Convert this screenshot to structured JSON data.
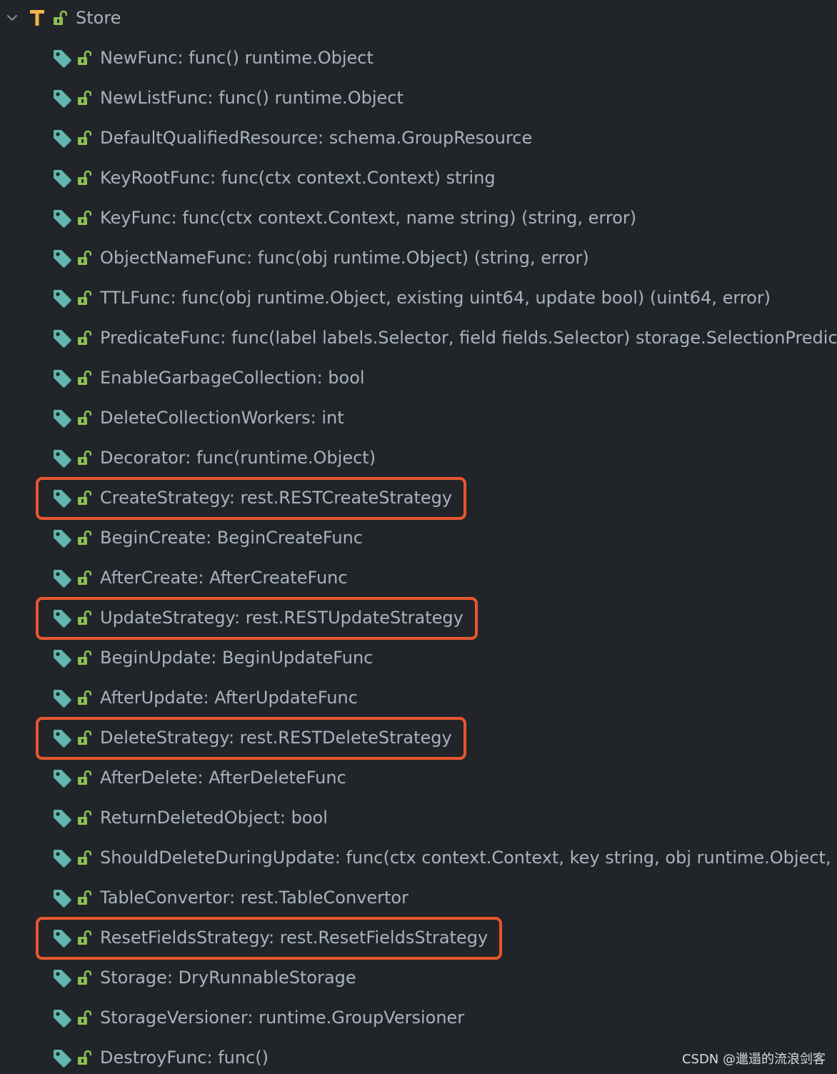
{
  "root": {
    "label": "Store",
    "type_icon": "type-T-icon",
    "lock_icon": "unlock-icon",
    "chevron_icon": "chevron-down-icon"
  },
  "colors": {
    "background": "#212529",
    "text": "#a7b3bd",
    "tag_icon": "#62b6b0",
    "lock_icon": "#8cc152",
    "type_icon": "#f2b54b",
    "highlight": "#e8562d"
  },
  "fields": [
    {
      "label": "NewFunc: func() runtime.Object",
      "highlighted": false
    },
    {
      "label": "NewListFunc: func() runtime.Object",
      "highlighted": false
    },
    {
      "label": "DefaultQualifiedResource: schema.GroupResource",
      "highlighted": false
    },
    {
      "label": "KeyRootFunc: func(ctx context.Context) string",
      "highlighted": false
    },
    {
      "label": "KeyFunc: func(ctx context.Context, name string) (string, error)",
      "highlighted": false
    },
    {
      "label": "ObjectNameFunc: func(obj runtime.Object) (string, error)",
      "highlighted": false
    },
    {
      "label": "TTLFunc: func(obj runtime.Object, existing uint64, update bool) (uint64, error)",
      "highlighted": false
    },
    {
      "label": "PredicateFunc: func(label labels.Selector, field fields.Selector) storage.SelectionPredicate",
      "highlighted": false
    },
    {
      "label": "EnableGarbageCollection: bool",
      "highlighted": false
    },
    {
      "label": "DeleteCollectionWorkers: int",
      "highlighted": false
    },
    {
      "label": "Decorator: func(runtime.Object)",
      "highlighted": false
    },
    {
      "label": "CreateStrategy: rest.RESTCreateStrategy",
      "highlighted": true
    },
    {
      "label": "BeginCreate: BeginCreateFunc",
      "highlighted": false
    },
    {
      "label": "AfterCreate: AfterCreateFunc",
      "highlighted": false
    },
    {
      "label": "UpdateStrategy: rest.RESTUpdateStrategy",
      "highlighted": true
    },
    {
      "label": "BeginUpdate: BeginUpdateFunc",
      "highlighted": false
    },
    {
      "label": "AfterUpdate: AfterUpdateFunc",
      "highlighted": false
    },
    {
      "label": "DeleteStrategy: rest.RESTDeleteStrategy",
      "highlighted": true
    },
    {
      "label": "AfterDelete: AfterDeleteFunc",
      "highlighted": false
    },
    {
      "label": "ReturnDeletedObject: bool",
      "highlighted": false
    },
    {
      "label": "ShouldDeleteDuringUpdate: func(ctx context.Context, key string, obj runtime.Object, exi",
      "highlighted": false
    },
    {
      "label": "TableConvertor: rest.TableConvertor",
      "highlighted": false
    },
    {
      "label": "ResetFieldsStrategy: rest.ResetFieldsStrategy",
      "highlighted": true
    },
    {
      "label": "Storage: DryRunnableStorage",
      "highlighted": false
    },
    {
      "label": "StorageVersioner: runtime.GroupVersioner",
      "highlighted": false
    },
    {
      "label": "DestroyFunc: func()",
      "highlighted": false
    }
  ],
  "field_icons": {
    "tag": "tag-icon",
    "lock": "unlock-icon"
  },
  "watermark": "CSDN @邋遢的流浪剑客"
}
